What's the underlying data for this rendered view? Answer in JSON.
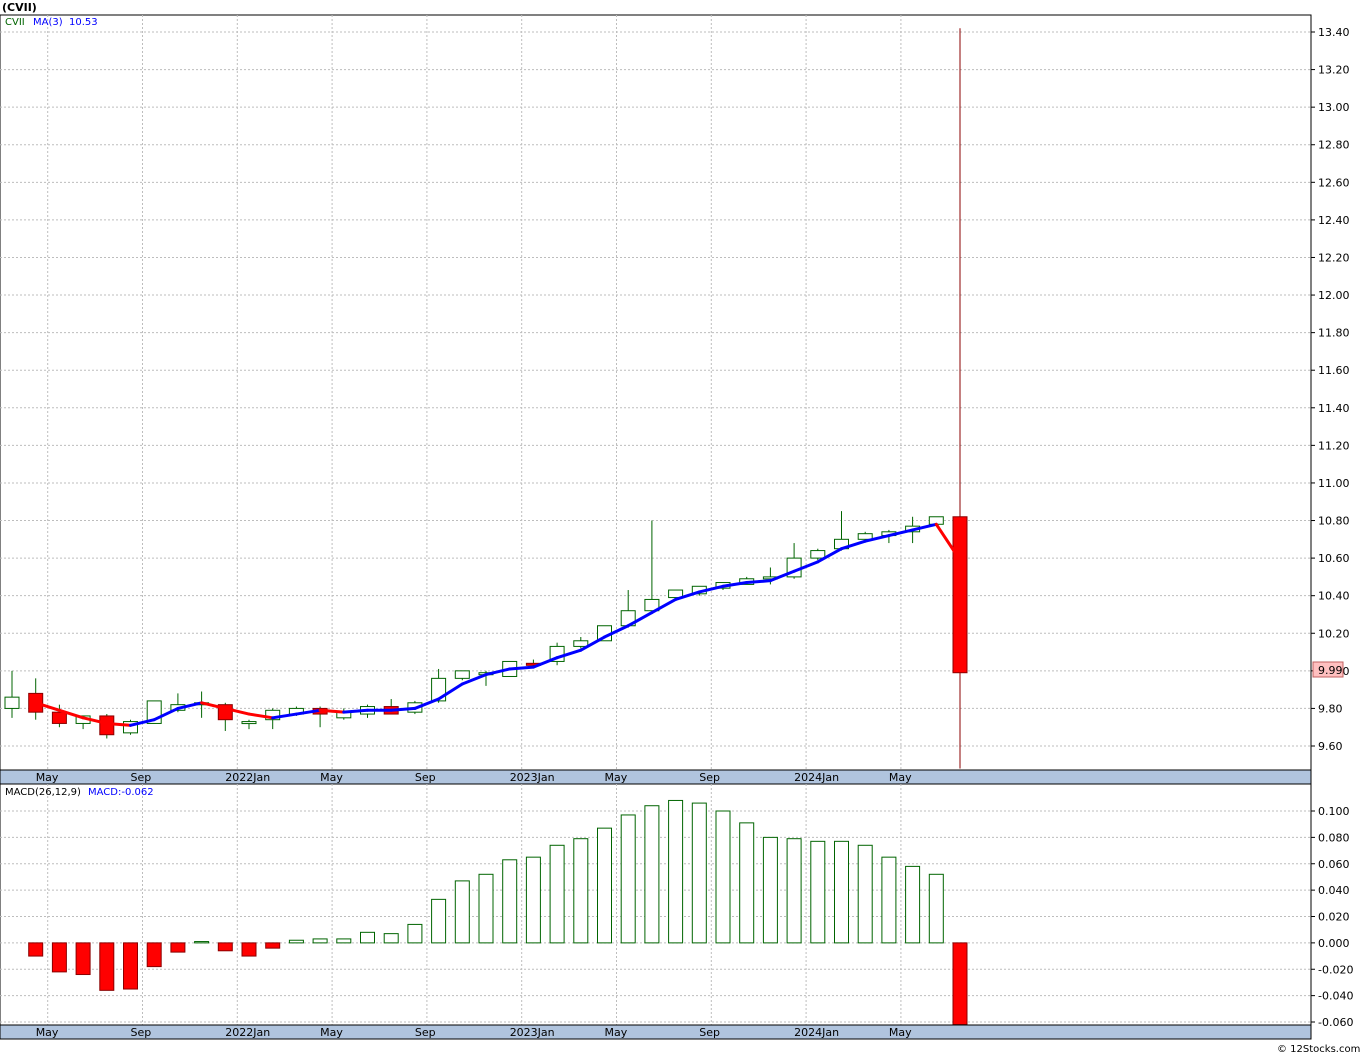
{
  "chart_data": [
    {
      "type": "candlestick",
      "title": "(CVII)",
      "legend": {
        "symbol": "CVII",
        "ma_label": "MA(3)",
        "ma_value": "10.53"
      },
      "last_price_label": "9.99",
      "ylim": [
        9.5,
        13.5
      ],
      "yticks": [
        "13.40",
        "13.20",
        "13.00",
        "12.80",
        "12.60",
        "12.40",
        "12.20",
        "12.00",
        "11.80",
        "11.60",
        "11.40",
        "11.20",
        "11.00",
        "10.80",
        "10.60",
        "10.40",
        "10.20",
        "10.00",
        "9.80",
        "9.60"
      ],
      "x_labels": [
        "May",
        "Sep",
        "2022Jan",
        "May",
        "Sep",
        "2023Jan",
        "May",
        "Sep",
        "2024Jan",
        "May"
      ],
      "candles": [
        {
          "o": 9.8,
          "h": 10.0,
          "l": 9.75,
          "c": 9.86
        },
        {
          "o": 9.88,
          "h": 9.96,
          "l": 9.74,
          "c": 9.78
        },
        {
          "o": 9.78,
          "h": 9.82,
          "l": 9.7,
          "c": 9.72
        },
        {
          "o": 9.72,
          "h": 9.76,
          "l": 9.69,
          "c": 9.76
        },
        {
          "o": 9.76,
          "h": 9.77,
          "l": 9.64,
          "c": 9.66
        },
        {
          "o": 9.67,
          "h": 9.74,
          "l": 9.66,
          "c": 9.73
        },
        {
          "o": 9.72,
          "h": 9.84,
          "l": 9.72,
          "c": 9.84
        },
        {
          "o": 9.79,
          "h": 9.88,
          "l": 9.78,
          "c": 9.82
        },
        {
          "o": 9.82,
          "h": 9.89,
          "l": 9.75,
          "c": 9.83
        },
        {
          "o": 9.82,
          "h": 9.83,
          "l": 9.68,
          "c": 9.74
        },
        {
          "o": 9.73,
          "h": 9.74,
          "l": 9.69,
          "c": 9.73
        },
        {
          "o": 9.74,
          "h": 9.8,
          "l": 9.69,
          "c": 9.79
        },
        {
          "o": 9.77,
          "h": 9.81,
          "l": 9.76,
          "c": 9.8
        },
        {
          "o": 9.8,
          "h": 9.81,
          "l": 9.7,
          "c": 9.77
        },
        {
          "o": 9.75,
          "h": 9.8,
          "l": 9.74,
          "c": 9.78
        },
        {
          "o": 9.77,
          "h": 9.82,
          "l": 9.75,
          "c": 9.81
        },
        {
          "o": 9.81,
          "h": 9.85,
          "l": 9.77,
          "c": 9.77
        },
        {
          "o": 9.78,
          "h": 9.84,
          "l": 9.77,
          "c": 9.83
        },
        {
          "o": 9.84,
          "h": 10.01,
          "l": 9.83,
          "c": 9.96
        },
        {
          "o": 9.96,
          "h": 10.0,
          "l": 9.95,
          "c": 10.0
        },
        {
          "o": 9.99,
          "h": 10.0,
          "l": 9.92,
          "c": 9.99
        },
        {
          "o": 9.97,
          "h": 10.05,
          "l": 9.97,
          "c": 10.05
        },
        {
          "o": 10.04,
          "h": 10.06,
          "l": 10.02,
          "c": 10.03
        },
        {
          "o": 10.05,
          "h": 10.15,
          "l": 10.03,
          "c": 10.13
        },
        {
          "o": 10.13,
          "h": 10.18,
          "l": 10.12,
          "c": 10.16
        },
        {
          "o": 10.16,
          "h": 10.24,
          "l": 10.16,
          "c": 10.24
        },
        {
          "o": 10.24,
          "h": 10.43,
          "l": 10.23,
          "c": 10.32
        },
        {
          "o": 10.32,
          "h": 10.8,
          "l": 10.31,
          "c": 10.38
        },
        {
          "o": 10.39,
          "h": 10.43,
          "l": 10.38,
          "c": 10.43
        },
        {
          "o": 10.41,
          "h": 10.45,
          "l": 10.4,
          "c": 10.45
        },
        {
          "o": 10.44,
          "h": 10.47,
          "l": 10.43,
          "c": 10.47
        },
        {
          "o": 10.46,
          "h": 10.5,
          "l": 10.46,
          "c": 10.49
        },
        {
          "o": 10.5,
          "h": 10.55,
          "l": 10.46,
          "c": 10.5
        },
        {
          "o": 10.5,
          "h": 10.68,
          "l": 10.49,
          "c": 10.6
        },
        {
          "o": 10.6,
          "h": 10.65,
          "l": 10.59,
          "c": 10.64
        },
        {
          "o": 10.65,
          "h": 10.85,
          "l": 10.64,
          "c": 10.7
        },
        {
          "o": 10.7,
          "h": 10.74,
          "l": 10.69,
          "c": 10.73
        },
        {
          "o": 10.72,
          "h": 10.75,
          "l": 10.68,
          "c": 10.74
        },
        {
          "o": 10.74,
          "h": 10.82,
          "l": 10.68,
          "c": 10.77
        },
        {
          "o": 10.78,
          "h": 10.82,
          "l": 10.78,
          "c": 10.82
        },
        {
          "o": 10.82,
          "h": 13.42,
          "l": 9.48,
          "c": 9.99
        }
      ],
      "ma": [
        null,
        9.83,
        9.79,
        9.75,
        9.72,
        9.71,
        9.74,
        9.8,
        9.83,
        9.8,
        9.77,
        9.75,
        9.77,
        9.79,
        9.78,
        9.79,
        9.79,
        9.8,
        9.85,
        9.93,
        9.98,
        10.01,
        10.02,
        10.07,
        10.11,
        10.18,
        10.24,
        10.31,
        10.38,
        10.42,
        10.45,
        10.47,
        10.48,
        10.53,
        10.58,
        10.65,
        10.69,
        10.72,
        10.75,
        10.78,
        10.59
      ]
    },
    {
      "type": "bar",
      "title": "MACD(26,12,9)",
      "legend": {
        "macd_label": "MACD:-0.062"
      },
      "ylim": [
        -0.064,
        0.115
      ],
      "yticks": [
        "0.100",
        "0.080",
        "0.060",
        "0.040",
        "0.020",
        "0.000",
        "-0.020",
        "-0.040",
        "-0.060"
      ],
      "x_labels": [
        "May",
        "Sep",
        "2022Jan",
        "May",
        "Sep",
        "2023Jan",
        "May",
        "Sep",
        "2024Jan",
        "May"
      ],
      "values": [
        null,
        -0.01,
        -0.022,
        -0.024,
        -0.036,
        -0.035,
        -0.018,
        -0.007,
        0.001,
        -0.006,
        -0.01,
        -0.004,
        0.002,
        0.003,
        0.003,
        0.008,
        0.007,
        0.014,
        0.033,
        0.047,
        0.052,
        0.063,
        0.065,
        0.074,
        0.079,
        0.087,
        0.097,
        0.104,
        0.108,
        0.106,
        0.1,
        0.091,
        0.08,
        0.079,
        0.077,
        0.077,
        0.074,
        0.065,
        0.058,
        0.052,
        -0.062
      ]
    }
  ],
  "footer": {
    "copyright": "© 12Stocks.com"
  },
  "colors": {
    "up": "#006400",
    "down": "#ff0000",
    "ma": "#0000ff",
    "axis_bar": "#b0c4de",
    "last_price_bg": "#ffc0c0"
  }
}
